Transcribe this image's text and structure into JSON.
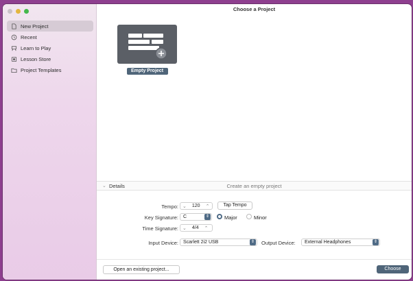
{
  "window": {
    "title": "Choose a Project"
  },
  "sidebar": {
    "items": [
      {
        "label": "New Project",
        "icon": "new-document-icon",
        "active": true
      },
      {
        "label": "Recent",
        "icon": "clock-icon"
      },
      {
        "label": "Learn to Play",
        "icon": "music-stand-icon"
      },
      {
        "label": "Lesson Store",
        "icon": "store-icon"
      },
      {
        "label": "Project Templates",
        "icon": "folder-icon"
      }
    ]
  },
  "tile": {
    "label": "Empty Project",
    "icon": "keyboard-plus-icon"
  },
  "details": {
    "title": "Details",
    "description": "Create an empty project",
    "tempo_label": "Tempo:",
    "tempo_value": "120",
    "tap_tempo": "Tap Tempo",
    "key_label": "Key Signature:",
    "key_value": "C",
    "major": "Major",
    "minor": "Minor",
    "time_label": "Time Signature:",
    "time_value": "4/4",
    "input_label": "Input Device:",
    "input_value": "Scarlett 2i2 USB",
    "output_label": "Output Device:",
    "output_value": "External Headphones"
  },
  "footer": {
    "open_existing": "Open an existing project...",
    "choose": "Choose"
  },
  "colors": {
    "accent": "#4f6579",
    "sidebar_bg": "#eed7ec",
    "tile_bg": "#5b5f66"
  }
}
